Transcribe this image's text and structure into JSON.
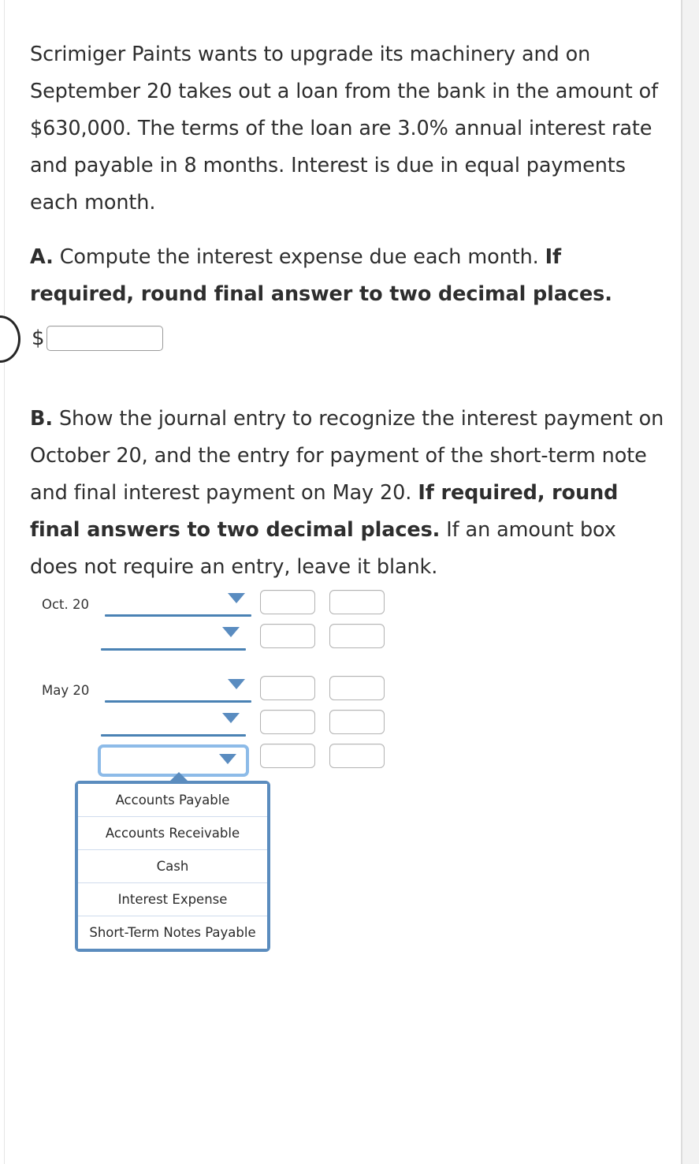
{
  "question": {
    "intro": "Scrimiger Paints wants to upgrade its machinery and on September 20 takes out a loan from the bank in the amount of $630,000. The terms of the loan are 3.0% annual interest rate and payable in 8 months. Interest is due in equal payments each month.",
    "part_a": {
      "label": "A.",
      "text": " Compute the interest expense due each month. ",
      "bold_text": "If required, round final answer to two decimal places.",
      "currency_symbol": "$",
      "answer_value": "",
      "answer_placeholder": ""
    },
    "part_b": {
      "label": "B.",
      "text": " Show the journal entry to recognize the interest payment on October 20, and the entry for payment of the short-term note and final interest payment on May 20. ",
      "bold_text": "If required, round final answers to two decimal places.",
      "tail_text": " If an amount box does not require an entry, leave it blank."
    }
  },
  "journal": {
    "groups": [
      {
        "date": "Oct. 20",
        "rows": [
          {
            "account": "",
            "debit": "",
            "credit": "",
            "indent": "indented"
          },
          {
            "account": "",
            "debit": "",
            "credit": "",
            "indent": "normal"
          }
        ]
      },
      {
        "date": "May 20",
        "rows": [
          {
            "account": "",
            "debit": "",
            "credit": "",
            "indent": "indented"
          },
          {
            "account": "",
            "debit": "",
            "credit": "",
            "indent": "normal"
          },
          {
            "account": "",
            "debit": "",
            "credit": "",
            "indent": "normal",
            "state": "focused-open"
          }
        ]
      }
    ]
  },
  "dropdown": {
    "open": true,
    "options": [
      "Accounts Payable",
      "Accounts Receivable",
      "Cash",
      "Interest Expense",
      "Short-Term Notes Payable"
    ]
  },
  "colors": {
    "select_underline": "#4a82b4",
    "caret": "#5a8cc0",
    "focus_ring": "#8dbbe8",
    "dropdown_border": "#5b8cbe",
    "input_border": "#b3b3b3",
    "text": "#2e2e2e"
  }
}
